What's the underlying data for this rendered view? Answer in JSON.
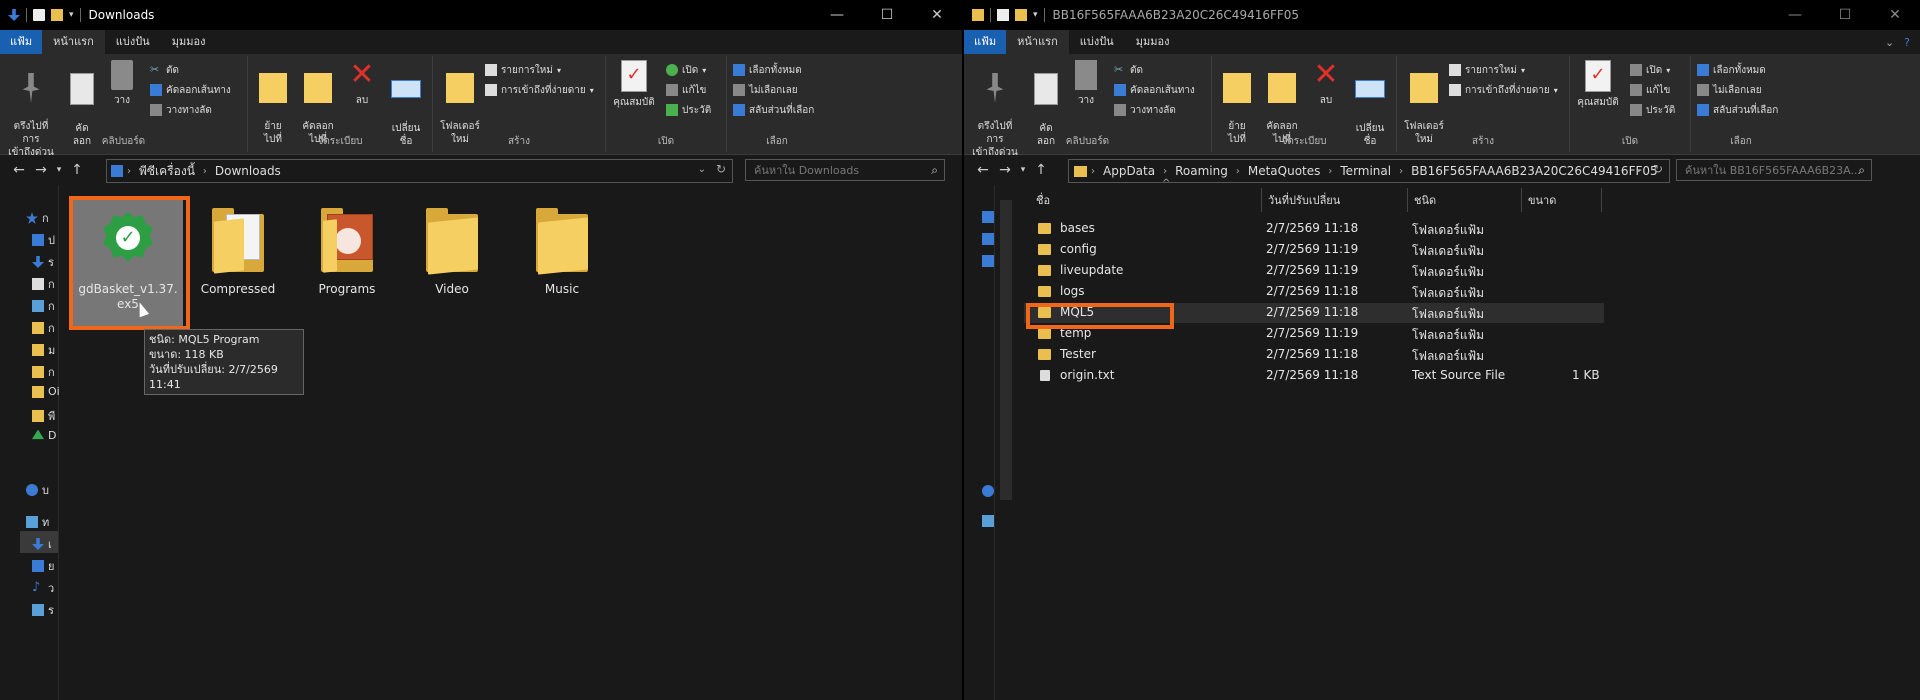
{
  "left": {
    "title": "Downloads",
    "tabs": [
      "แฟ้ม",
      "หน้าแรก",
      "แบ่งปัน",
      "มุมมอง"
    ],
    "ribbon": {
      "pin": "ตรึงไปที่การ\nเข้าถึงด่วน",
      "copy": "คัด\nลอก",
      "paste": "วาง",
      "cut": "ตัด",
      "copy_path": "คัดลอกเส้นทาง",
      "paste_shortcut": "วางทางลัด",
      "clipboard_label": "คลิปบอร์ด",
      "move_to": "ย้าย\nไปที่",
      "copy_to": "คัดลอก\nไปที่",
      "delete": "ลบ",
      "rename": "เปลี่ยน\nชื่อ",
      "organize_label": "จัดระเบียบ",
      "new_folder": "โฟลเดอร์\nใหม่",
      "new_item": "รายการใหม่",
      "easy_access": "การเข้าถึงที่ง่ายดาย",
      "new_label": "สร้าง",
      "properties": "คุณสมบัติ",
      "open": "เปิด",
      "edit": "แก้ไข",
      "history": "ประวัติ",
      "open_label": "เปิด",
      "select_all": "เลือกทั้งหมด",
      "select_none": "ไม่เลือกเลย",
      "invert_selection": "สลับส่วนที่เลือก",
      "select_label": "เลือก"
    },
    "address": [
      "พีซีเครื่องนี้",
      "Downloads"
    ],
    "search_placeholder": "ค้นหาใน Downloads",
    "items": [
      {
        "name": "gdBasket_v1.37.ex5"
      },
      {
        "name": "Compressed"
      },
      {
        "name": "Programs"
      },
      {
        "name": "Video"
      },
      {
        "name": "Music"
      }
    ],
    "tooltip": {
      "type": "ชนิด: MQL5 Program",
      "size": "ขนาด: 118 KB",
      "modified": "วันที่ปรับเปลี่ยน: 2/7/2569 11:41"
    },
    "sidebar_labels": [
      "ก",
      "ป",
      "ร",
      "ก",
      "ก",
      "ก",
      "ม",
      "ก",
      "Oi",
      "พี",
      "D",
      "บ",
      "ท",
      "เ",
      "ย",
      "ว",
      "ร"
    ]
  },
  "right": {
    "title": "BB16F565FAAA6B23A20C26C49416FF05",
    "tabs": [
      "แฟ้ม",
      "หน้าแรก",
      "แบ่งปัน",
      "มุมมอง"
    ],
    "address": [
      "AppData",
      "Roaming",
      "MetaQuotes",
      "Terminal",
      "BB16F565FAAA6B23A20C26C49416FF05"
    ],
    "search_placeholder": "ค้นหาใน BB16F565FAAA6B23A...",
    "columns": [
      "ชื่อ",
      "วันที่ปรับเปลี่ยน",
      "ชนิด",
      "ขนาด"
    ],
    "rows": [
      {
        "name": "bases",
        "date": "2/7/2569 11:18",
        "type": "โฟลเดอร์แฟ้ม",
        "size": ""
      },
      {
        "name": "config",
        "date": "2/7/2569 11:19",
        "type": "โฟลเดอร์แฟ้ม",
        "size": ""
      },
      {
        "name": "liveupdate",
        "date": "2/7/2569 11:19",
        "type": "โฟลเดอร์แฟ้ม",
        "size": ""
      },
      {
        "name": "logs",
        "date": "2/7/2569 11:18",
        "type": "โฟลเดอร์แฟ้ม",
        "size": ""
      },
      {
        "name": "MQL5",
        "date": "2/7/2569 11:18",
        "type": "โฟลเดอร์แฟ้ม",
        "size": ""
      },
      {
        "name": "temp",
        "date": "2/7/2569 11:19",
        "type": "โฟลเดอร์แฟ้ม",
        "size": ""
      },
      {
        "name": "Tester",
        "date": "2/7/2569 11:18",
        "type": "โฟลเดอร์แฟ้ม",
        "size": ""
      },
      {
        "name": "origin.txt",
        "date": "2/7/2569 11:18",
        "type": "Text Source File",
        "size": "1 KB"
      }
    ]
  },
  "colors": {
    "highlight": "#f0671a",
    "file_tab": "#1a60b0",
    "folder": "#f5cf62"
  }
}
